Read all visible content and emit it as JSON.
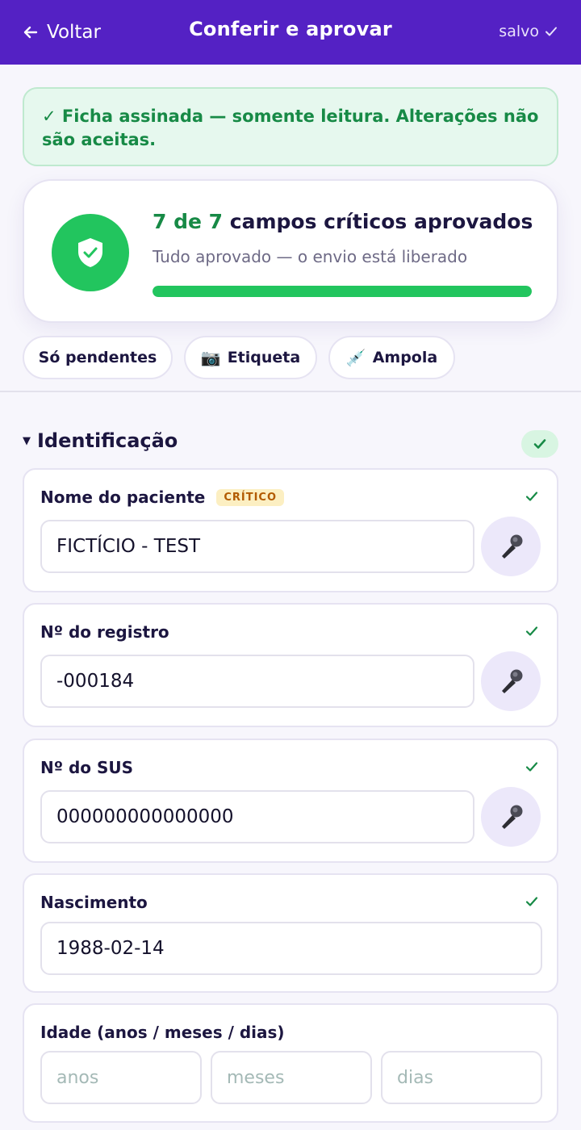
{
  "header": {
    "back_label": "Voltar",
    "title": "Conferir e aprovar",
    "saved_label": "salvo"
  },
  "banner": {
    "text": "✓ Ficha assinada — somente leitura. Alterações não são aceitas."
  },
  "summary": {
    "count_text": "7 de 7",
    "title_rest": " campos críticos aprovados",
    "subtitle": "Tudo aprovado — o envio está liberado",
    "progress_fraction": 1.0
  },
  "filters": [
    {
      "label": "Só pendentes",
      "glyph": ""
    },
    {
      "label": "Etiqueta",
      "glyph": "📷"
    },
    {
      "label": "Ampola",
      "glyph": "💉"
    }
  ],
  "section": {
    "title": "Identificação"
  },
  "fields": [
    {
      "label": "Nome do paciente",
      "badge": "CRÍTICO",
      "value": "FICTÍCIO - TEST"
    },
    {
      "label": "Nº do registro",
      "value": "-000184"
    },
    {
      "label": "Nº do SUS",
      "value": "000000000000000"
    },
    {
      "label": "Nascimento",
      "value": "1988-02-14"
    },
    {
      "label": "Idade (anos / meses / dias)",
      "placeholders": [
        "anos",
        "meses",
        "dias"
      ]
    }
  ],
  "colors": {
    "header_bg": "#5421c4",
    "success": "#22c55e",
    "success_text": "#178a46",
    "critical_badge_bg": "#fcefc2"
  },
  "icons": {
    "back": "arrow-left-icon",
    "saved": "check-icon",
    "shield": "shield-check-icon",
    "mic": "microphone-icon"
  }
}
